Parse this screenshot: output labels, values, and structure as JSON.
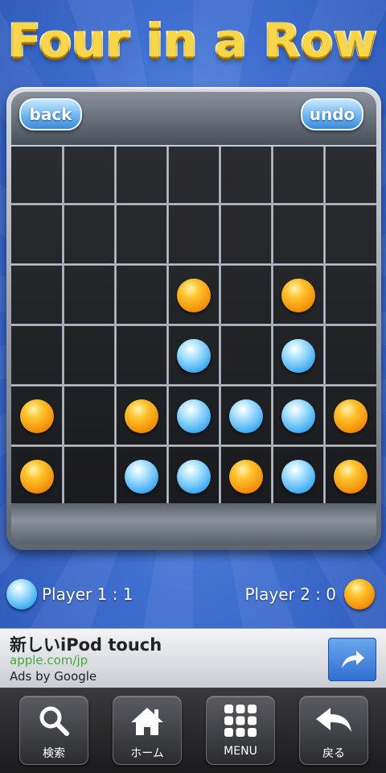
{
  "title": "Four in a Row",
  "buttons": {
    "back": "back",
    "undo": "undo"
  },
  "board": {
    "columns": 7,
    "rows": 6,
    "cells": [
      [
        "empty",
        "empty",
        "empty",
        "empty",
        "empty",
        "empty",
        "empty"
      ],
      [
        "empty",
        "empty",
        "empty",
        "empty",
        "empty",
        "empty",
        "empty"
      ],
      [
        "empty",
        "empty",
        "empty",
        "orange",
        "empty",
        "orange",
        "empty"
      ],
      [
        "empty",
        "empty",
        "empty",
        "blue",
        "empty",
        "blue",
        "empty"
      ],
      [
        "orange",
        "empty",
        "orange",
        "blue",
        "blue",
        "blue",
        "orange"
      ],
      [
        "orange",
        "empty",
        "blue",
        "blue",
        "orange",
        "blue",
        "orange"
      ]
    ]
  },
  "scores": {
    "player1": {
      "label": "Player 1 : 1",
      "color": "blue"
    },
    "player2": {
      "label": "Player 2 : 0",
      "color": "orange"
    }
  },
  "ad": {
    "title": "新しいiPod touch",
    "url": "apple.com/jp",
    "by": "Ads by Google"
  },
  "tabs": [
    {
      "label": "検索",
      "icon": "search-icon"
    },
    {
      "label": "ホーム",
      "icon": "home-icon"
    },
    {
      "label": "MENU",
      "icon": "menu-grid-icon"
    },
    {
      "label": "戻る",
      "icon": "back-arrow-icon"
    }
  ],
  "colors": {
    "title": "#f7d64a",
    "pill": "#6fb6f0",
    "orange_disc": "#f5a010",
    "blue_disc": "#3da9ef",
    "ad_url": "#4aa73a"
  }
}
